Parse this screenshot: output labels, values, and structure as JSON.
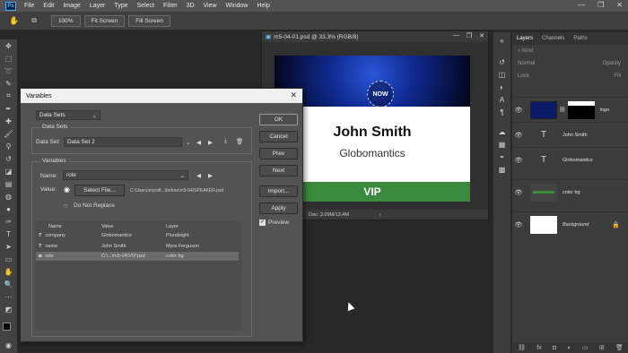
{
  "menubar": {
    "items": [
      "File",
      "Edit",
      "Image",
      "Layer",
      "Type",
      "Select",
      "Filter",
      "3D",
      "View",
      "Window",
      "Help"
    ]
  },
  "options": {
    "zoom": "100%",
    "fit_screen": "Fit Screen",
    "fill_screen": "Fill Screen"
  },
  "document": {
    "tab_title": "m5-04-01.psd @ 33.3% (RGB/8)",
    "status": "Doc: 3.09M/13.4M",
    "card": {
      "logo": "NOW",
      "name": "John Smith",
      "company": "Globomantics",
      "badge": "VIP"
    }
  },
  "layers_panel": {
    "tabs": [
      "Layers",
      "Channels",
      "Paths"
    ],
    "filter": "Kind",
    "blend": "Normal",
    "opacity_label": "Opacity",
    "lock_label": "Lock",
    "fill_label": "Fill",
    "layers": [
      {
        "name": "logo",
        "type": "image"
      },
      {
        "name": "John Smith",
        "type": "text"
      },
      {
        "name": "Globomantics",
        "type": "text"
      },
      {
        "name": "color bg",
        "type": "fill"
      },
      {
        "name": "Background",
        "type": "background"
      }
    ]
  },
  "variables_dialog": {
    "title": "Variables",
    "section_dropdown": "Data Sets",
    "group_datasets": "Data Sets",
    "data_set_label": "Data Set:",
    "data_set_value": "Data Set 2",
    "group_variables": "Variables",
    "name_label": "Name:",
    "name_value": "role",
    "value_label": "Value:",
    "select_file": "Select File...",
    "file_path": "C:\\Users\\myrafl...\\before\\m5-04\\SPEAKER.psd",
    "do_not_replace": "Do Not Replace",
    "buttons": {
      "ok": "OK",
      "cancel": "Cancel",
      "prev": "Prev",
      "next": "Next",
      "import": "Import...",
      "apply": "Apply"
    },
    "preview": "Preview",
    "table": {
      "headers": [
        "Name",
        "Value",
        "Layer"
      ],
      "rows": [
        {
          "name": "company",
          "value": "Globomantics",
          "layer": "Pluralsight"
        },
        {
          "name": "name",
          "value": "John Smith",
          "layer": "Myra Ferguson"
        },
        {
          "name": "role",
          "value": "C:\\...\\m5-04\\VIP.psd",
          "layer": "color bg"
        }
      ]
    }
  }
}
